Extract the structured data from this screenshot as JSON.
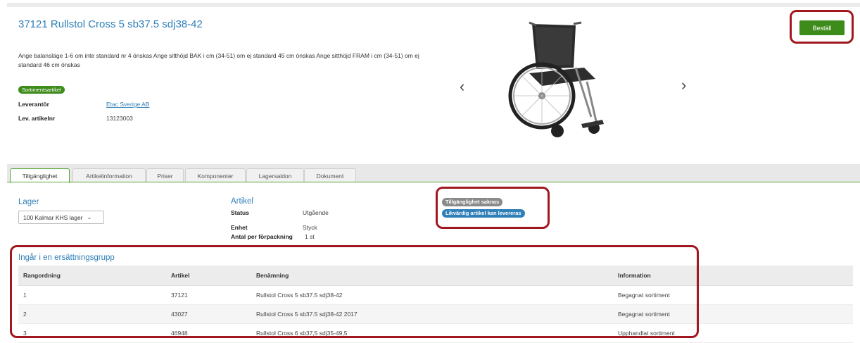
{
  "product": {
    "title": "37121 Rullstol Cross 5 sb37.5 sdj38-42",
    "description": "Ange balansläge 1-6 om inte standard nr 4 önskas Ange sitthöjd BAK i cm (34-51) om ej standard 45 cm önskas Ange sitthöjd FRAM i cm (34-51) om ej standard 46 cm önskas",
    "badge": "Sortimentsartikel",
    "supplier_label": "Leverantör",
    "supplier_value": "Etac Sverige AB",
    "supplier_artno_label": "Lev. artikelnr",
    "supplier_artno_value": "13123003",
    "image_icon": "wheelchair-photo"
  },
  "carousel": {
    "prev": "‹",
    "next": "›"
  },
  "order_button": "Beställ",
  "tabs": [
    {
      "label": "Tillgänglighet",
      "active": true
    },
    {
      "label": "Artikelinformation",
      "active": false
    },
    {
      "label": "Priser",
      "active": false
    },
    {
      "label": "Komponenter",
      "active": false
    },
    {
      "label": "Lagersaldon",
      "active": false
    },
    {
      "label": "Dokument",
      "active": false
    }
  ],
  "stock": {
    "title": "Lager",
    "selected": "100 Kalmar KHS lager"
  },
  "article": {
    "title": "Artikel",
    "status_label": "Status",
    "status_value": "Utgående",
    "unit_label": "Enhet",
    "unit_value": "Styck",
    "per_pack_label": "Antal per förpackning",
    "per_pack_value": "1 st"
  },
  "availability": {
    "missing": "Tillgänglighet saknas",
    "equivalent": "Likvärdig artikel kan levereras"
  },
  "replacement_group": {
    "title": "Ingår i en ersättningsgrupp",
    "columns": [
      "Rangordning",
      "Artikel",
      "Benämning",
      "Information"
    ],
    "rows": [
      [
        "1",
        "37121",
        "Rullstol Cross 5 sb37.5 sdj38-42",
        "Begagnat sortiment"
      ],
      [
        "2",
        "43027",
        "Rullstol Cross 5 sb37.5 sdj38-42 2017",
        "Begagnat sortiment"
      ],
      [
        "3",
        "46948",
        "Rullstol Cross 6 sb37,5 sdj35-49,5",
        "Upphandlat sortiment"
      ]
    ]
  },
  "colors": {
    "accent_blue": "#2f7fb8",
    "brand_green": "#3d8b1a",
    "highlight_red": "#a0181e",
    "gray_badge": "#8a8a8a"
  }
}
